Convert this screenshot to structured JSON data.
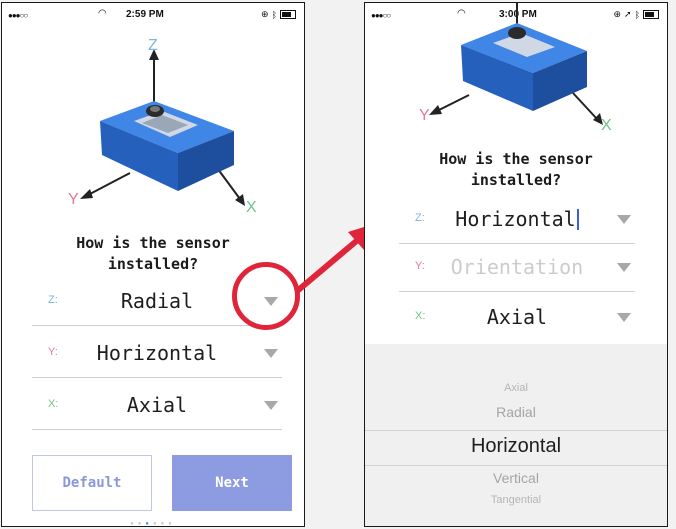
{
  "left_screen": {
    "status": {
      "time": "2:59 PM"
    },
    "axis_labels": {
      "z": "Z",
      "y": "Y",
      "x": "X"
    },
    "question": {
      "line1": "How is the sensor",
      "line2": "installed?"
    },
    "rows": [
      {
        "axis": "Z:",
        "value": "Radial"
      },
      {
        "axis": "Y:",
        "value": "Horizontal"
      },
      {
        "axis": "X:",
        "value": "Axial"
      }
    ],
    "buttons": {
      "default": "Default",
      "next": "Next"
    },
    "page_dots": {
      "count": 6,
      "active_index": 2
    }
  },
  "right_screen": {
    "status": {
      "time": "3:00 PM"
    },
    "axis_labels": {
      "y": "Y",
      "x": "X"
    },
    "question": {
      "line1": "How is the sensor",
      "line2": "installed?"
    },
    "rows": [
      {
        "axis": "Z:",
        "value": "Horizontal"
      },
      {
        "axis": "Y:",
        "value": "Orientation"
      },
      {
        "axis": "X:",
        "value": "Axial"
      }
    ],
    "picker_options": [
      "Axial",
      "Radial",
      "Horizontal",
      "Vertical",
      "Tangential"
    ],
    "picker_selected": "Horizontal"
  },
  "colors": {
    "accent": "#8d9be0",
    "callout": "#e0253b",
    "sensor_blue": "#2f6fd0",
    "axis_z": "#7fb5d9",
    "axis_y": "#e27a94",
    "axis_x": "#6fc489"
  }
}
